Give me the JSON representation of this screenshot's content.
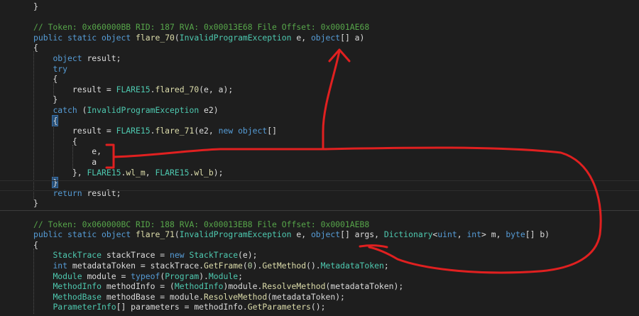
{
  "code_lines": [
    {
      "segments": [
        {
          "t": "}",
          "c": "p"
        }
      ]
    },
    {
      "segments": []
    },
    {
      "segments": [
        {
          "t": "// Token: 0x060000BB RID: 187 RVA: 0x00013E68 File Offset: 0x0001AE68",
          "c": "c"
        }
      ]
    },
    {
      "segments": [
        {
          "t": "public",
          "c": "k"
        },
        {
          "t": " ",
          "c": "p"
        },
        {
          "t": "static",
          "c": "k"
        },
        {
          "t": " ",
          "c": "p"
        },
        {
          "t": "object",
          "c": "k"
        },
        {
          "t": " ",
          "c": "p"
        },
        {
          "t": "flare_70",
          "c": "m"
        },
        {
          "t": "(",
          "c": "p"
        },
        {
          "t": "InvalidProgramException",
          "c": "t"
        },
        {
          "t": " e, ",
          "c": "p"
        },
        {
          "t": "object",
          "c": "k"
        },
        {
          "t": "[] a)",
          "c": "p"
        }
      ]
    },
    {
      "segments": [
        {
          "t": "{",
          "c": "p"
        }
      ]
    },
    {
      "segments": [
        {
          "t": "    ",
          "c": "p"
        },
        {
          "t": "object",
          "c": "k"
        },
        {
          "t": " result;",
          "c": "p"
        }
      ]
    },
    {
      "segments": [
        {
          "t": "    ",
          "c": "p"
        },
        {
          "t": "try",
          "c": "k"
        }
      ]
    },
    {
      "segments": [
        {
          "t": "    {",
          "c": "p"
        }
      ]
    },
    {
      "segments": [
        {
          "t": "        result = ",
          "c": "p"
        },
        {
          "t": "FLARE15",
          "c": "t"
        },
        {
          "t": ".",
          "c": "p"
        },
        {
          "t": "flared_70",
          "c": "m"
        },
        {
          "t": "(e, a);",
          "c": "p"
        }
      ]
    },
    {
      "segments": [
        {
          "t": "    }",
          "c": "p"
        }
      ]
    },
    {
      "segments": [
        {
          "t": "    ",
          "c": "p"
        },
        {
          "t": "catch",
          "c": "k"
        },
        {
          "t": " (",
          "c": "p"
        },
        {
          "t": "InvalidProgramException",
          "c": "t"
        },
        {
          "t": " e2)",
          "c": "p"
        }
      ]
    },
    {
      "segments": [
        {
          "t": "    ",
          "c": "p"
        },
        {
          "t": "{",
          "c": "p",
          "hl": true
        }
      ]
    },
    {
      "segments": [
        {
          "t": "        result = ",
          "c": "p"
        },
        {
          "t": "FLARE15",
          "c": "t"
        },
        {
          "t": ".",
          "c": "p"
        },
        {
          "t": "flare_71",
          "c": "m"
        },
        {
          "t": "(e2, ",
          "c": "p"
        },
        {
          "t": "new",
          "c": "k"
        },
        {
          "t": " ",
          "c": "p"
        },
        {
          "t": "object",
          "c": "k"
        },
        {
          "t": "[]",
          "c": "p"
        }
      ]
    },
    {
      "segments": [
        {
          "t": "        {",
          "c": "p"
        }
      ]
    },
    {
      "segments": [
        {
          "t": "            e,",
          "c": "p"
        }
      ]
    },
    {
      "segments": [
        {
          "t": "            a",
          "c": "p"
        }
      ]
    },
    {
      "segments": [
        {
          "t": "        }, ",
          "c": "p"
        },
        {
          "t": "FLARE15",
          "c": "t"
        },
        {
          "t": ".",
          "c": "p"
        },
        {
          "t": "wl_m",
          "c": "m"
        },
        {
          "t": ", ",
          "c": "p"
        },
        {
          "t": "FLARE15",
          "c": "t"
        },
        {
          "t": ".",
          "c": "p"
        },
        {
          "t": "wl_b",
          "c": "m"
        },
        {
          "t": ");",
          "c": "p"
        }
      ]
    },
    {
      "segments": [
        {
          "t": "    ",
          "c": "p"
        },
        {
          "t": "}",
          "c": "p",
          "hl": true
        }
      ]
    },
    {
      "segments": [
        {
          "t": "    ",
          "c": "p"
        },
        {
          "t": "return",
          "c": "k"
        },
        {
          "t": " result;",
          "c": "p"
        }
      ]
    },
    {
      "segments": [
        {
          "t": "}",
          "c": "p"
        }
      ]
    },
    {
      "segments": []
    },
    {
      "segments": [
        {
          "t": "// Token: 0x060000BC RID: 188 RVA: 0x00013EB8 File Offset: 0x0001AEB8",
          "c": "c"
        }
      ]
    },
    {
      "segments": [
        {
          "t": "public",
          "c": "k"
        },
        {
          "t": " ",
          "c": "p"
        },
        {
          "t": "static",
          "c": "k"
        },
        {
          "t": " ",
          "c": "p"
        },
        {
          "t": "object",
          "c": "k"
        },
        {
          "t": " ",
          "c": "p"
        },
        {
          "t": "flare_71",
          "c": "m"
        },
        {
          "t": "(",
          "c": "p"
        },
        {
          "t": "InvalidProgramException",
          "c": "t"
        },
        {
          "t": " e, ",
          "c": "p"
        },
        {
          "t": "object",
          "c": "k"
        },
        {
          "t": "[] args, ",
          "c": "p"
        },
        {
          "t": "Dictionary",
          "c": "t"
        },
        {
          "t": "<",
          "c": "p"
        },
        {
          "t": "uint",
          "c": "k"
        },
        {
          "t": ", ",
          "c": "p"
        },
        {
          "t": "int",
          "c": "k"
        },
        {
          "t": "> m, ",
          "c": "p"
        },
        {
          "t": "byte",
          "c": "k"
        },
        {
          "t": "[] b)",
          "c": "p"
        }
      ]
    },
    {
      "segments": [
        {
          "t": "{",
          "c": "p"
        }
      ]
    },
    {
      "segments": [
        {
          "t": "    ",
          "c": "p"
        },
        {
          "t": "StackTrace",
          "c": "t"
        },
        {
          "t": " stackTrace = ",
          "c": "p"
        },
        {
          "t": "new",
          "c": "k"
        },
        {
          "t": " ",
          "c": "p"
        },
        {
          "t": "StackTrace",
          "c": "t"
        },
        {
          "t": "(e);",
          "c": "p"
        }
      ]
    },
    {
      "segments": [
        {
          "t": "    ",
          "c": "p"
        },
        {
          "t": "int",
          "c": "k"
        },
        {
          "t": " metadataToken = stackTrace.",
          "c": "p"
        },
        {
          "t": "GetFrame",
          "c": "m"
        },
        {
          "t": "(",
          "c": "p"
        },
        {
          "t": "0",
          "c": "n"
        },
        {
          "t": ").",
          "c": "p"
        },
        {
          "t": "GetMethod",
          "c": "m"
        },
        {
          "t": "().",
          "c": "p"
        },
        {
          "t": "MetadataToken",
          "c": "t"
        },
        {
          "t": ";",
          "c": "p"
        }
      ]
    },
    {
      "segments": [
        {
          "t": "    ",
          "c": "p"
        },
        {
          "t": "Module",
          "c": "t"
        },
        {
          "t": " module = ",
          "c": "p"
        },
        {
          "t": "typeof",
          "c": "k"
        },
        {
          "t": "(",
          "c": "p"
        },
        {
          "t": "Program",
          "c": "t"
        },
        {
          "t": ").",
          "c": "p"
        },
        {
          "t": "Module",
          "c": "t"
        },
        {
          "t": ";",
          "c": "p"
        }
      ]
    },
    {
      "segments": [
        {
          "t": "    ",
          "c": "p"
        },
        {
          "t": "MethodInfo",
          "c": "t"
        },
        {
          "t": " methodInfo = (",
          "c": "p"
        },
        {
          "t": "MethodInfo",
          "c": "t"
        },
        {
          "t": ")module.",
          "c": "p"
        },
        {
          "t": "ResolveMethod",
          "c": "m"
        },
        {
          "t": "(metadataToken);",
          "c": "p"
        }
      ]
    },
    {
      "segments": [
        {
          "t": "    ",
          "c": "p"
        },
        {
          "t": "MethodBase",
          "c": "t"
        },
        {
          "t": " methodBase = module.",
          "c": "p"
        },
        {
          "t": "ResolveMethod",
          "c": "m"
        },
        {
          "t": "(metadataToken);",
          "c": "p"
        }
      ]
    },
    {
      "segments": [
        {
          "t": "    ",
          "c": "p"
        },
        {
          "t": "ParameterInfo",
          "c": "t"
        },
        {
          "t": "[] parameters = methodInfo.",
          "c": "p"
        },
        {
          "t": "GetParameters",
          "c": "m"
        },
        {
          "t": "();",
          "c": "p"
        }
      ]
    }
  ],
  "colors": {
    "background": "#1e1e1e",
    "keyword": "#569cd6",
    "type": "#4ec9b0",
    "method": "#dcdcaa",
    "comment": "#57a64a",
    "number": "#b5cea8",
    "plain": "#dcdcdc",
    "annotation": "#e02020"
  }
}
